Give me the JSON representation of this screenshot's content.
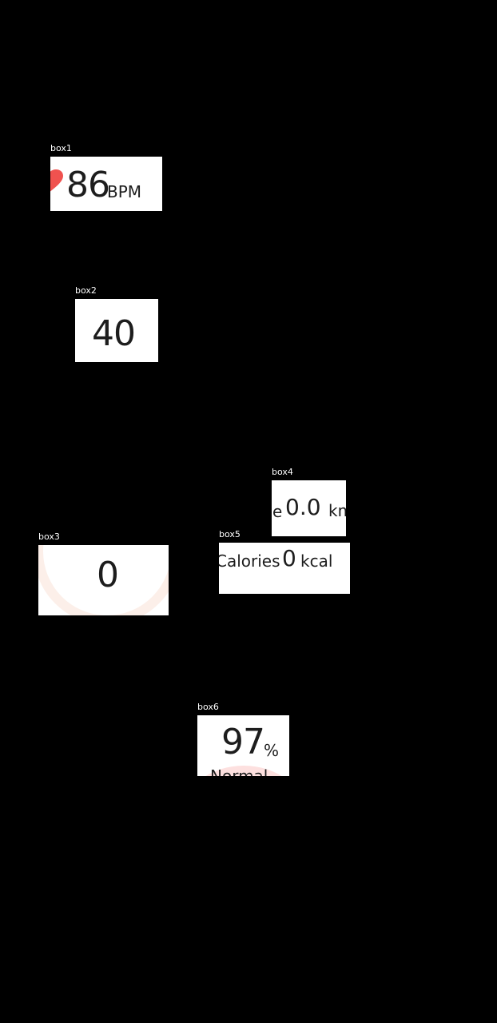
{
  "labels": {
    "box1": "box1",
    "box2": "box2",
    "box3": "box3",
    "box4": "box4",
    "box5": "box5",
    "box6": "box6"
  },
  "heart_rate": {
    "value": "86",
    "unit": "BPM",
    "icon": "heart-icon",
    "icon_color": "#f0524f"
  },
  "box2": {
    "value": "40"
  },
  "ring_metric": {
    "value": "0",
    "ring_color": "#fcefe9"
  },
  "distance": {
    "lead_text": "e",
    "value": "0.0",
    "unit": "km"
  },
  "calories": {
    "label": "Calories",
    "value": "0",
    "unit": "kcal"
  },
  "spo2": {
    "value": "97",
    "unit": "%",
    "status": "Normal",
    "arc_color": "#fde0df"
  },
  "colors": {
    "background": "#000000",
    "card": "#ffffff",
    "text": "#1d1d1d"
  }
}
